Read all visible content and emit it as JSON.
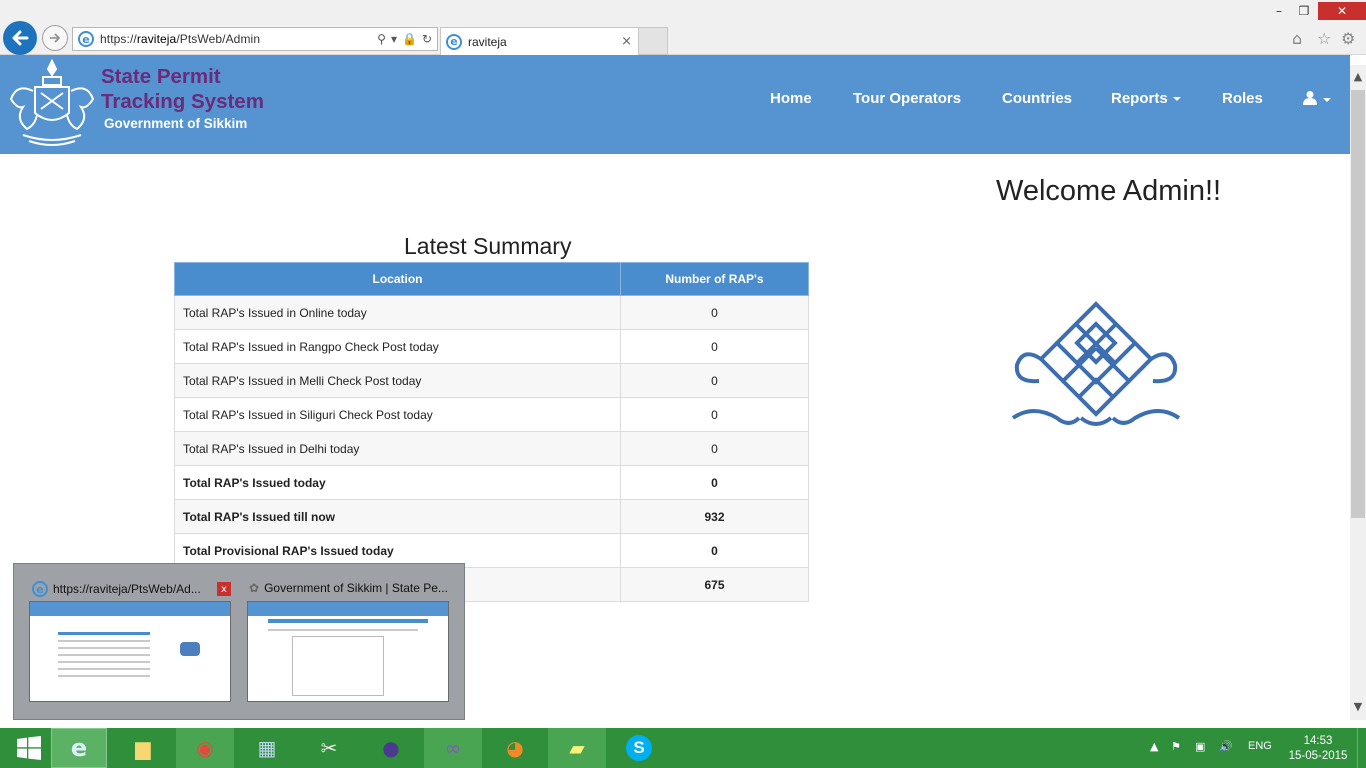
{
  "browser": {
    "url_scheme": "https://",
    "url_host": "raviteja",
    "url_path": "/PtsWeb/Admin",
    "tab_title": "raviteja",
    "tab_close": "×",
    "win_minimize": "–",
    "win_maximize": "❐",
    "win_close": "✕"
  },
  "header": {
    "title_line1": "State Permit",
    "title_line2": "Tracking System",
    "subtitle": "Government of Sikkim",
    "menu": [
      {
        "label": "Home"
      },
      {
        "label": "Tour Operators"
      },
      {
        "label": "Countries"
      },
      {
        "label": "Reports"
      },
      {
        "label": "Roles"
      }
    ],
    "user_icon": "user-icon"
  },
  "main": {
    "welcome": "Welcome Admin!!",
    "summary_title": "Latest Summary",
    "table": {
      "headers": [
        "Location",
        "Number of RAP's"
      ],
      "rows": [
        {
          "label": "Total RAP's Issued in Online today",
          "value": "0"
        },
        {
          "label": "Total RAP's Issued in Rangpo Check Post today",
          "value": "0"
        },
        {
          "label": "Total RAP's Issued in Melli Check Post today",
          "value": "0"
        },
        {
          "label": "Total RAP's Issued in Siliguri Check Post today",
          "value": "0"
        },
        {
          "label": "Total RAP's Issued in Delhi today",
          "value": "0"
        },
        {
          "label": "Total RAP's Issued today",
          "value": "0"
        },
        {
          "label": "Total RAP's Issued till now",
          "value": "932"
        },
        {
          "label": "Total Provisional RAP's Issued today",
          "value": "0"
        },
        {
          "label": "",
          "value": "675"
        }
      ]
    }
  },
  "preview": {
    "window1_title": "https://raviteja/PtsWeb/Ad...",
    "window2_title": "Government of Sikkim | State Pe...",
    "close": "x"
  },
  "taskbar": {
    "language": "ENG",
    "time": "14:53",
    "date": "15-05-2015"
  },
  "colors": {
    "header_blue": "#5594d1",
    "brand_purple": "#6b2a7a",
    "table_header": "#4a8dcf",
    "taskbar_green": "#2f8f3a"
  }
}
